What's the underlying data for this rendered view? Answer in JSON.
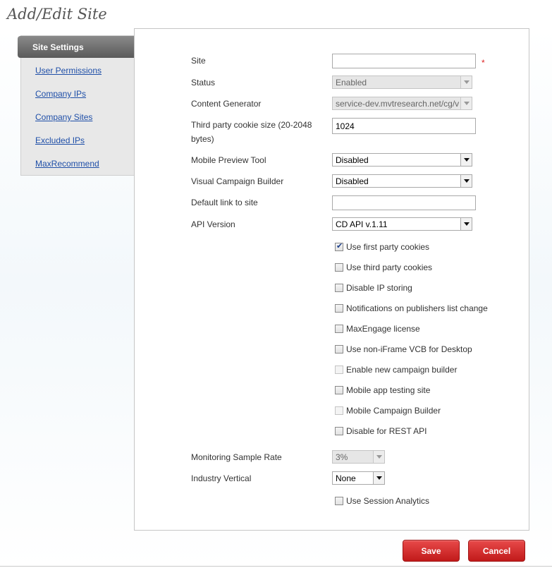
{
  "page": {
    "title": "Add/Edit Site"
  },
  "sidebar": {
    "active": "Site Settings",
    "links": [
      "User Permissions",
      "Company IPs",
      "Company Sites",
      "Excluded IPs",
      "MaxRecommend"
    ]
  },
  "form": {
    "site": {
      "label": "Site",
      "value": "",
      "required_mark": "*"
    },
    "status": {
      "label": "Status",
      "value": "Enabled"
    },
    "content_generator": {
      "label": "Content Generator",
      "value": "service-dev.mvtresearch.net/cg/v"
    },
    "cookie_size": {
      "label_line1": "Third party cookie size (20-2048",
      "label_line2": "bytes)",
      "value": "1024"
    },
    "mobile_preview": {
      "label": "Mobile Preview Tool",
      "value": "Disabled"
    },
    "visual_campaign": {
      "label": "Visual Campaign Builder",
      "value": "Disabled"
    },
    "default_link": {
      "label": "Default link to site",
      "value": ""
    },
    "api_version": {
      "label": "API Version",
      "value": "CD API v.1.11"
    },
    "checkboxes": [
      {
        "label": "Use first party cookies",
        "checked": true,
        "disabled": false
      },
      {
        "label": "Use third party cookies",
        "checked": false,
        "disabled": false
      },
      {
        "label": "Disable IP storing",
        "checked": false,
        "disabled": false
      },
      {
        "label": "Notifications on publishers list change",
        "checked": false,
        "disabled": false
      },
      {
        "label": "MaxEngage license",
        "checked": false,
        "disabled": false
      },
      {
        "label": "Use non-iFrame VCB for Desktop",
        "checked": false,
        "disabled": false
      },
      {
        "label": "Enable new campaign builder",
        "checked": false,
        "disabled": true
      },
      {
        "label": "Mobile app testing site",
        "checked": false,
        "disabled": false
      },
      {
        "label": "Mobile Campaign Builder",
        "checked": false,
        "disabled": true
      },
      {
        "label": "Disable for REST API",
        "checked": false,
        "disabled": false
      }
    ],
    "monitoring_rate": {
      "label": "Monitoring Sample Rate",
      "value": "3%"
    },
    "industry_vertical": {
      "label": "Industry Vertical",
      "value": "None"
    },
    "session_analytics": {
      "label": "Use Session Analytics",
      "checked": false
    }
  },
  "buttons": {
    "save": "Save",
    "cancel": "Cancel"
  }
}
